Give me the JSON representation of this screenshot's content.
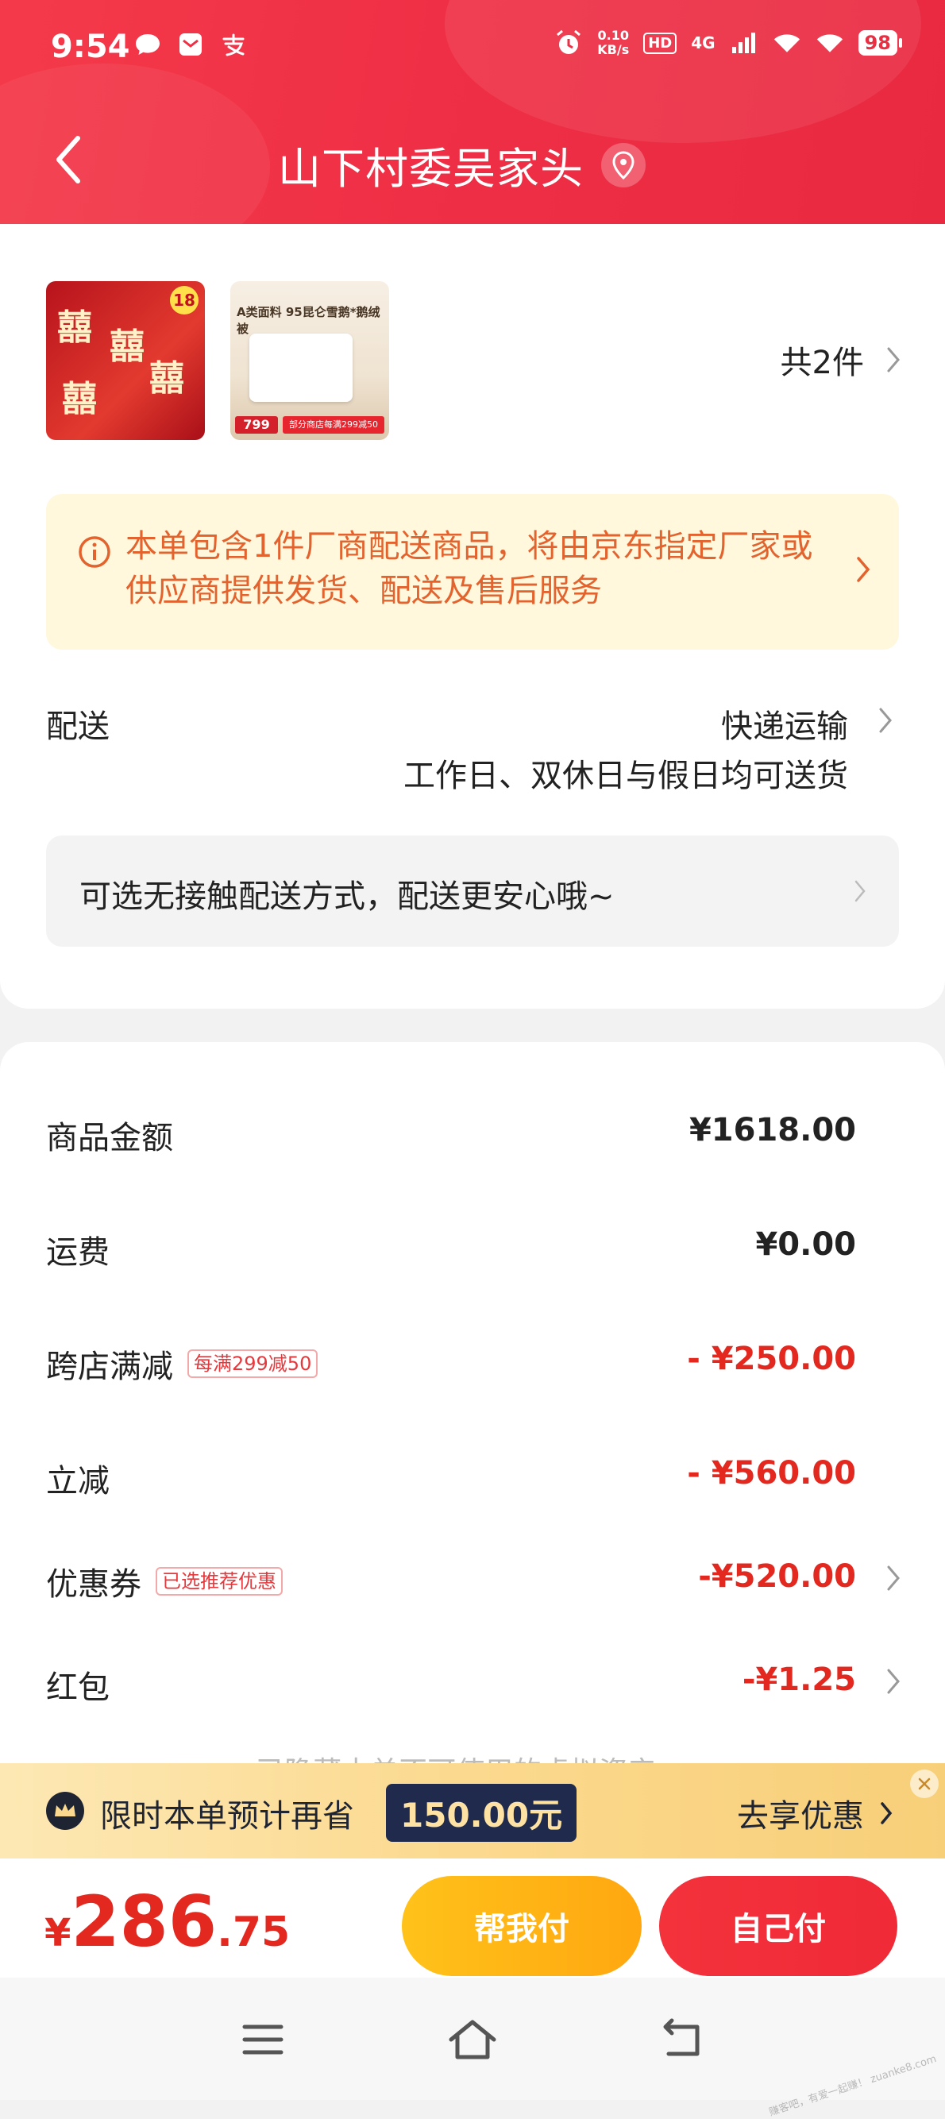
{
  "status_bar": {
    "time": "9:54",
    "network_speed_top": "0.10",
    "network_speed_bottom": "KB/s",
    "hd_label": "HD",
    "network_type": "4G",
    "battery": "98",
    "icons": [
      "message-icon",
      "mail-icon",
      "alipay-icon",
      "alarm-icon",
      "signal-icon",
      "wifi-icon",
      "battery-icon"
    ]
  },
  "header": {
    "title": "山下村委吴家头",
    "back_icon": "chevron-left-icon",
    "location_icon": "location-pin-icon"
  },
  "products": {
    "count_label": "共2件",
    "thumb1": {
      "badge": "18",
      "glyph": "囍"
    },
    "thumb2": {
      "title": "A类面料 95昆仑雪鹅*鹅绒被",
      "price": "799",
      "promo": "部分商店每满299减50"
    }
  },
  "notice": {
    "text": "本单包含1件厂商配送商品，将由京东指定厂家或供应商提供发货、配送及售后服务"
  },
  "shipping": {
    "label": "配送",
    "method": "快递运输",
    "note": "工作日、双休日与假日均可送货",
    "contactless": "可选无接触配送方式，配送更安心哦~"
  },
  "fees": [
    {
      "label": "商品金额",
      "tag": "",
      "value": "¥1618.00",
      "red": false,
      "chevron": false
    },
    {
      "label": "运费",
      "tag": "",
      "value": "¥0.00",
      "red": false,
      "chevron": false
    },
    {
      "label": "跨店满减",
      "tag": "每满299减50",
      "value": "- ¥250.00",
      "red": true,
      "chevron": false
    },
    {
      "label": "立减",
      "tag": "",
      "value": "- ¥560.00",
      "red": true,
      "chevron": false
    },
    {
      "label": "优惠券",
      "tag": "已选推荐优惠",
      "value": "-¥520.00",
      "red": true,
      "chevron": true
    },
    {
      "label": "红包",
      "tag": "",
      "value": "-¥1.25",
      "red": true,
      "chevron": true
    }
  ],
  "hidden_assets": "已隐藏本单不可使用的虚拟资产 ⌄",
  "promo": {
    "text": "限时本单预计再省",
    "amount": "150.00元",
    "cta": "去享优惠"
  },
  "total": {
    "currency": "¥",
    "integer": "286",
    "decimal": ".75"
  },
  "buttons": {
    "help_pay": "帮我付",
    "self_pay": "自己付"
  },
  "watermark": "赚客吧，有爱一起赚！ zuanke8.com",
  "colors": {
    "brand_red": "#ef2f45",
    "price_red": "#e3281f",
    "notice_bg": "#fff8dc",
    "notice_text": "#e3632f",
    "help_button": "#ffb416",
    "promo_bg": "#fbd98e"
  }
}
